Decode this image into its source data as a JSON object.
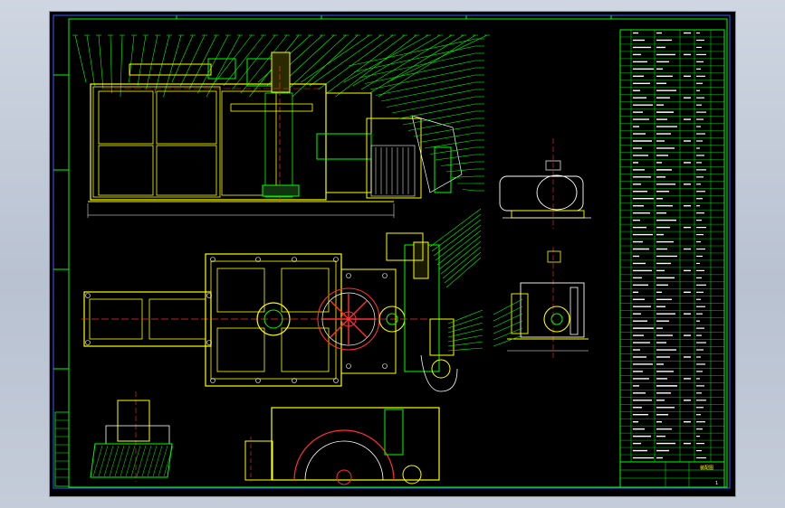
{
  "viewport": {
    "background": "#000000",
    "colors": {
      "border": "#00ff00",
      "outline": "#ffff00",
      "hatch": "#00ff00",
      "center": "#ff3030",
      "detail": "#ffffff",
      "leader": "#00ff00",
      "frame_blue": "#3a5bff",
      "accent_cyan": "#00ffff",
      "accent_magenta": "#ff00ff"
    }
  },
  "title_block": {
    "label": "装配图",
    "sheet_no": "1",
    "rows": 60
  },
  "views": {
    "front": "front-view",
    "plan": "plan-view",
    "side_top": "side-view-top",
    "side_bottom": "side-view-bottom",
    "detail": "detail-section",
    "gear": "gear-section"
  }
}
